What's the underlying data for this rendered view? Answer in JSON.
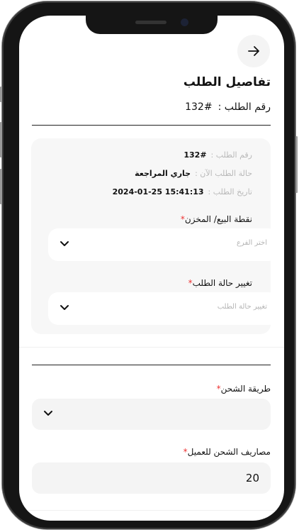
{
  "page": {
    "title": "تفاصيل الطلب",
    "order_number_label": "رقم الطلب :",
    "order_number_value": "#132"
  },
  "details": {
    "order_no_label": "رقم الطلب :",
    "order_no_value": "#132",
    "status_label": "حالة الطلب الآن :",
    "status_value": "جاري المراجعة",
    "date_label": "تاريخ الطلب :",
    "date_value": "2024-01-25 15:41:13"
  },
  "branch": {
    "label": "نقطة البيع/ المخزن",
    "required_mark": "*",
    "placeholder": "اختر الفرع"
  },
  "status_change": {
    "label": "تغيير حالة الطلب",
    "required_mark": "*",
    "placeholder": "تغيير حالة الطلب"
  },
  "shipping": {
    "method_label": "طريقة الشحن",
    "method_required_mark": "*",
    "cost_label": "مصاريف الشحن للعميل",
    "cost_required_mark": "*",
    "cost_value": "20"
  },
  "icons": {
    "back": "arrow-right-icon",
    "dropdown": "chevron-down-icon"
  }
}
